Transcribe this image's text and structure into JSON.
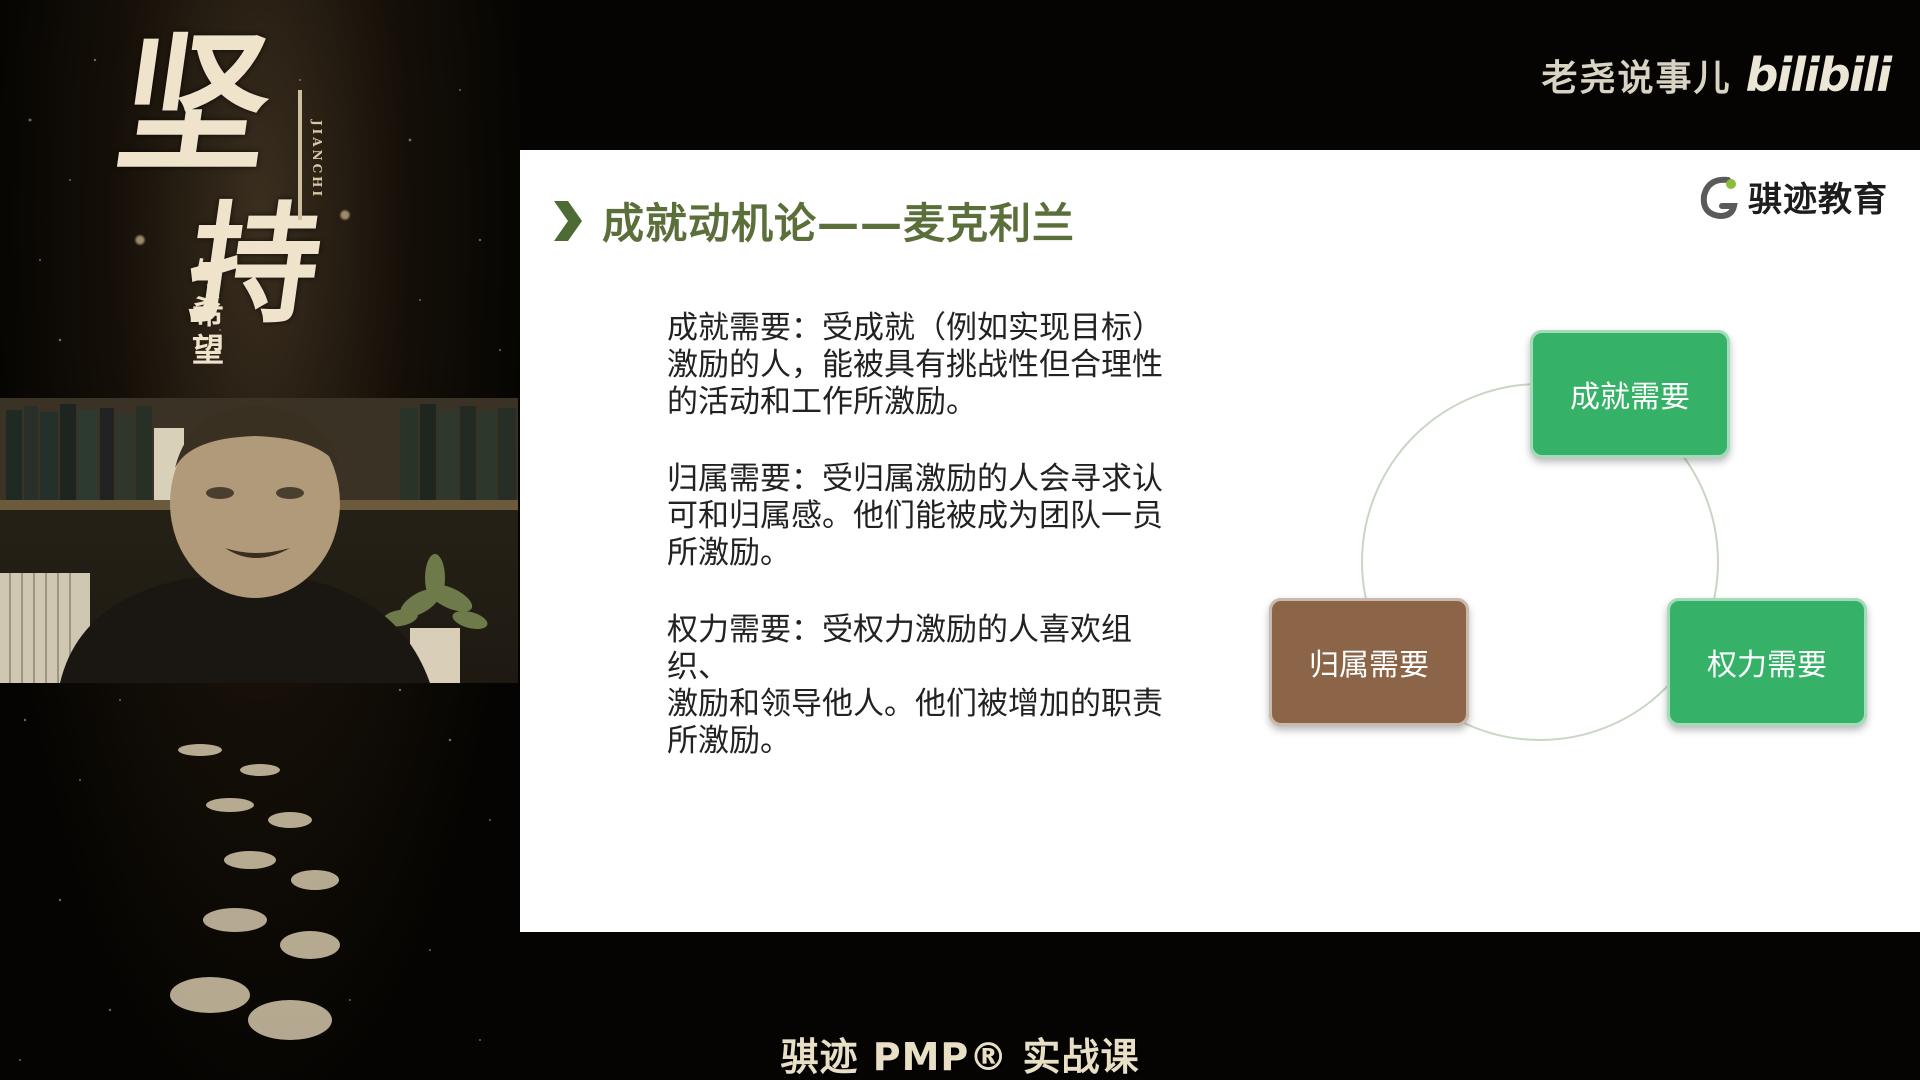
{
  "background": {
    "calligraphy_main": "坚持",
    "calligraphy_sub": "与希望",
    "calligraphy_pinyin": "JIANCHI"
  },
  "brand": {
    "channel_name": "老尧说事儿",
    "platform_logo": "bilibili"
  },
  "slide": {
    "title": "成就动机论——麦克利兰",
    "logo_text": "骐迹教育",
    "paragraphs": [
      "成就需要：受成就（例如实现目标）\n激励的人，能被具有挑战性但合理性\n的活动和工作所激励。",
      "归属需要：受归属激励的人会寻求认\n可和归属感。他们能被成为团队一员\n所激励。",
      "权力需要：受权力激励的人喜欢组织、\n激励和领导他人。他们被增加的职责\n所激励。"
    ],
    "diagram": {
      "achievement": "成就需要",
      "affiliation": "归属需要",
      "power": "权力需要"
    }
  },
  "caption": "骐迹 PMP® 实战课",
  "colors": {
    "title_green": "#5b6f3b",
    "box_green": "#35b268",
    "box_brown": "#8c6548"
  }
}
